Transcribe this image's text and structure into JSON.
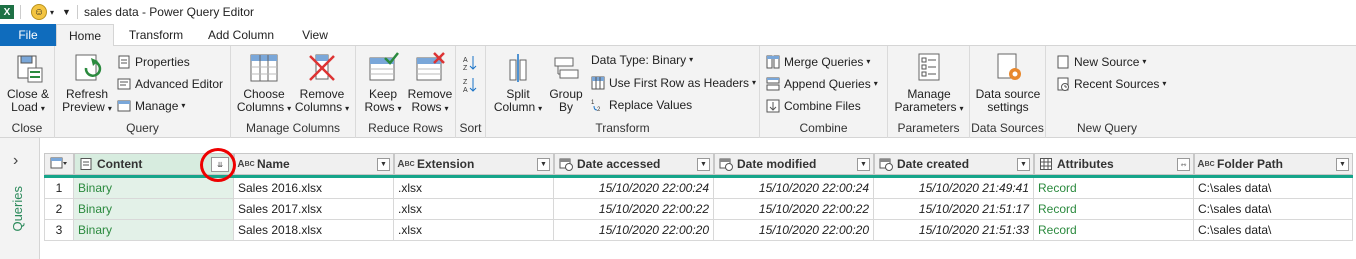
{
  "window": {
    "title": "sales data - Power Query Editor",
    "app_icon": "X"
  },
  "tabs": [
    "File",
    "Home",
    "Transform",
    "Add Column",
    "View"
  ],
  "ribbon": {
    "close": {
      "btn1": "Close &",
      "btn2": "Load",
      "group": "Close"
    },
    "query": {
      "refresh1": "Refresh",
      "refresh2": "Preview",
      "properties": "Properties",
      "advanced": "Advanced Editor",
      "manage": "Manage",
      "group": "Query"
    },
    "manage_columns": {
      "choose1": "Choose",
      "choose2": "Columns",
      "remove1": "Remove",
      "remove2": "Columns",
      "group": "Manage Columns"
    },
    "reduce_rows": {
      "keep1": "Keep",
      "keep2": "Rows",
      "remove1": "Remove",
      "remove2": "Rows",
      "group": "Reduce Rows"
    },
    "sort": {
      "group": "Sort"
    },
    "transform": {
      "split1": "Split",
      "split2": "Column",
      "group1": "Group",
      "group2": "By",
      "datatype": "Data Type: Binary",
      "firstrow": "Use First Row as Headers",
      "replace": "Replace Values",
      "group": "Transform"
    },
    "combine": {
      "merge": "Merge Queries",
      "append": "Append Queries",
      "files": "Combine Files",
      "group": "Combine"
    },
    "parameters": {
      "btn1": "Manage",
      "btn2": "Parameters",
      "group": "Parameters"
    },
    "datasources": {
      "btn1": "Data source",
      "btn2": "settings",
      "group": "Data Sources"
    },
    "newquery": {
      "newsource": "New Source",
      "recent": "Recent Sources",
      "group": "New Query"
    }
  },
  "queries_label": "Queries",
  "columns": [
    {
      "name": "Content",
      "type": "doc"
    },
    {
      "name": "Name",
      "type": "ABC"
    },
    {
      "name": "Extension",
      "type": "ABC"
    },
    {
      "name": "Date accessed",
      "type": "date"
    },
    {
      "name": "Date modified",
      "type": "date"
    },
    {
      "name": "Date created",
      "type": "date"
    },
    {
      "name": "Attributes",
      "type": "table"
    },
    {
      "name": "Folder Path",
      "type": "ABC"
    }
  ],
  "rows": [
    {
      "n": "1",
      "content": "Binary",
      "name": "Sales 2016.xlsx",
      "ext": ".xlsx",
      "accessed": "15/10/2020 22:00:24",
      "modified": "15/10/2020 22:00:24",
      "created": "15/10/2020 21:49:41",
      "attributes": "Record",
      "path": "C:\\sales data\\"
    },
    {
      "n": "2",
      "content": "Binary",
      "name": "Sales 2017.xlsx",
      "ext": ".xlsx",
      "accessed": "15/10/2020 22:00:22",
      "modified": "15/10/2020 22:00:22",
      "created": "15/10/2020 21:51:17",
      "attributes": "Record",
      "path": "C:\\sales data\\"
    },
    {
      "n": "3",
      "content": "Binary",
      "name": "Sales 2018.xlsx",
      "ext": ".xlsx",
      "accessed": "15/10/2020 22:00:20",
      "modified": "15/10/2020 22:00:20",
      "created": "15/10/2020 21:51:33",
      "attributes": "Record",
      "path": "C:\\sales data\\"
    }
  ],
  "colors": {
    "accent": "#0f6cbd",
    "binary_bg": "#e3f1e8",
    "green_text": "#2b8a3e",
    "column_bar": "#16a58a",
    "annotation": "#ee0000"
  }
}
